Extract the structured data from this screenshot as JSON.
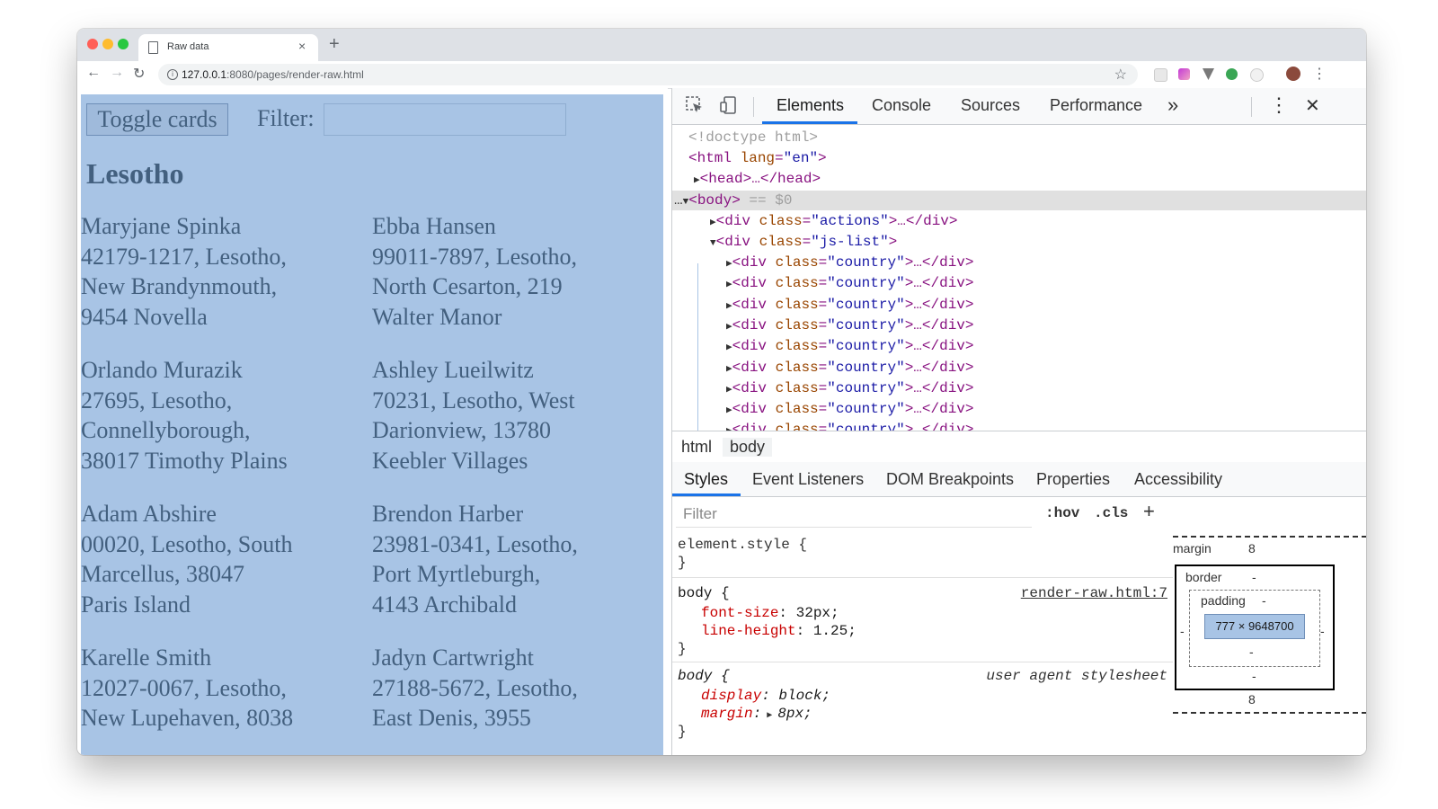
{
  "browser": {
    "tab_title": "Raw data",
    "tab_close": "×",
    "new_tab": "+",
    "url_host": "127.0.0.1",
    "url_rest": ":8080/pages/render-raw.html",
    "info_glyph": "i",
    "bookmark_glyph": "☆",
    "back_glyph": "←",
    "forward_glyph": "→",
    "reload_glyph": "↻",
    "menu_glyph": "⋮"
  },
  "page": {
    "toggle_label": "Toggle cards",
    "filter_label": "Filter:",
    "filter_value": "",
    "country": "Lesotho",
    "cards": [
      {
        "name": "Maryjane Spinka",
        "line1": "42179-1217, Lesotho,",
        "line2": "New Brandynmouth,",
        "line3": "9454 Novella"
      },
      {
        "name": "Ebba Hansen",
        "line1": "99011-7897, Lesotho,",
        "line2": "North Cesarton, 219",
        "line3": "Walter Manor"
      },
      {
        "name": "Orlando Murazik",
        "line1": "27695, Lesotho,",
        "line2": "Connellyborough,",
        "line3": "38017 Timothy Plains"
      },
      {
        "name": "Ashley Lueilwitz",
        "line1": "70231, Lesotho, West",
        "line2": "Darionview, 13780",
        "line3": "Keebler Villages"
      },
      {
        "name": "Adam Abshire",
        "line1": "00020, Lesotho, South",
        "line2": "Marcellus, 38047",
        "line3": "Paris Island"
      },
      {
        "name": "Brendon Harber",
        "line1": "23981-0341, Lesotho,",
        "line2": "Port Myrtleburgh,",
        "line3": "4143 Archibald"
      },
      {
        "name": "Karelle Smith",
        "line1": "12027-0067, Lesotho,",
        "line2": "New Lupehaven, 8038",
        "line3": ""
      },
      {
        "name": "Jadyn Cartwright",
        "line1": "27188-5672, Lesotho,",
        "line2": "East Denis, 3955",
        "line3": ""
      }
    ]
  },
  "devtools": {
    "tabs": [
      "Elements",
      "Console",
      "Sources",
      "Performance"
    ],
    "more_glyph": "»",
    "kebab_glyph": "⋮",
    "close_glyph": "✕",
    "dom": {
      "doctype": "<!doctype html>",
      "html_open": "<html",
      "lang_attr": "lang",
      "lang_val": "\"en\"",
      "head": "<head>…</head>",
      "body_tag": "<body>",
      "body_eq": " == $0",
      "div_open": "<div",
      "class_attr": "class",
      "actions_val": "\"actions\"",
      "jslist_val": "\"js-list\"",
      "country_val": "\"country\"",
      "collapsed_end": ">…</div>",
      "close_gt": ">",
      "ellipsis": "…"
    },
    "crumbs": [
      "html",
      "body"
    ],
    "subtabs": [
      "Styles",
      "Event Listeners",
      "DOM Breakpoints",
      "Properties",
      "Accessibility"
    ],
    "styles": {
      "filter_placeholder": "Filter",
      "hov": ":hov",
      "cls": ".cls",
      "plus": "+",
      "element_style": "element.style {",
      "close_brace": "}",
      "body_selector": "body {",
      "body_source": "render-raw.html:7",
      "font_size_prop": "font-size",
      "font_size_val": "32px;",
      "line_height_prop": "line-height",
      "line_height_val": "1.25;",
      "ua_selector": "body {",
      "ua_label": "user agent stylesheet",
      "display_prop": "display",
      "display_val": "block;",
      "margin_prop": "margin",
      "margin_val": "8px;"
    },
    "boxmodel": {
      "margin_label": "margin",
      "margin_top": "8",
      "margin_bottom": "8",
      "border_label": "border",
      "border_val": "-",
      "padding_label": "padding",
      "padding_val": "-",
      "content_size": "777 × 9648700",
      "dash": "-"
    }
  },
  "colors": {
    "body_highlight": "#a8c4e5",
    "text_on_highlight": "#43607f",
    "accent": "#1a73e8"
  }
}
